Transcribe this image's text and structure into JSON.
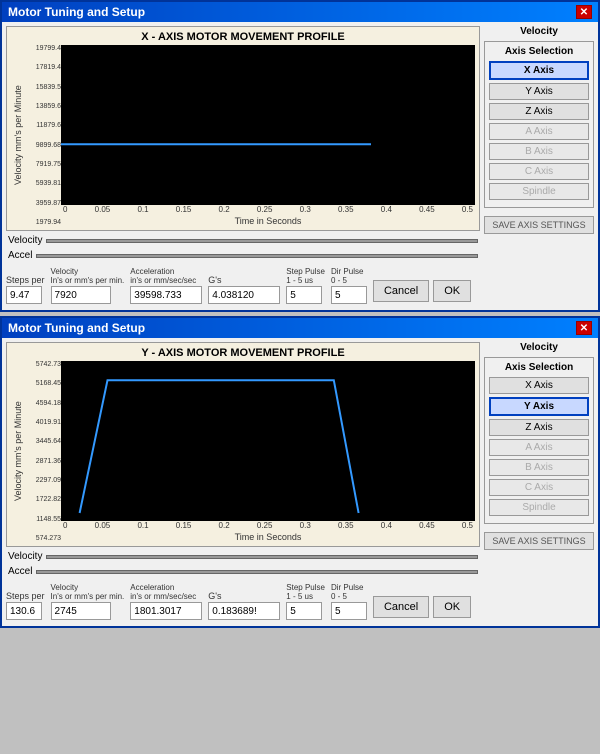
{
  "windows": [
    {
      "id": "window1",
      "title": "Motor Tuning and Setup",
      "chart_title": "X - AXIS MOTOR MOVEMENT PROFILE",
      "y_axis_label": "Velocity mm's per Minute",
      "x_axis_label": "Time in Seconds",
      "y_ticks": [
        "19799.4",
        "17819.4",
        "15839.5",
        "13859.6",
        "11879.6",
        "9899.68",
        "7919.75",
        "5939.81",
        "3959.87",
        "1979.94"
      ],
      "x_ticks": [
        "0",
        "0.05",
        "0.1",
        "0.15",
        "0.2",
        "0.25",
        "0.3",
        "0.35",
        "0.4",
        "0.45",
        "0.5"
      ],
      "velocity_label": "Velocity",
      "accel_label": "Accel",
      "line_y_pct": 0.62,
      "active_axis": "X Axis",
      "axis_buttons": [
        "X Axis",
        "Y Axis",
        "Z Axis",
        "A Axis",
        "B Axis",
        "C Axis",
        "Spindle"
      ],
      "inputs": {
        "steps_per_label": "Steps per",
        "steps_per_value": "9.47",
        "velocity_label": "Velocity\nIn's or mm's per min.",
        "velocity_value": "7920",
        "acceleration_label": "Acceleration\nin's or mm/sec/sec",
        "acceleration_value": "39598.733",
        "gs_label": "G's",
        "gs_value": "4.038120",
        "step_pulse_label": "Step Pulse\n1 - 5 us",
        "step_pulse_value": "5",
        "dir_pulse_label": "Dir Pulse\n0 - 5",
        "dir_pulse_value": "5"
      },
      "save_label": "SAVE AXIS SETTINGS",
      "cancel_label": "Cancel",
      "ok_label": "OK"
    },
    {
      "id": "window2",
      "title": "Motor Tuning and Setup",
      "chart_title": "Y - AXIS MOTOR MOVEMENT PROFILE",
      "y_axis_label": "Velocity mm's per Minute",
      "x_axis_label": "Time in Seconds",
      "y_ticks": [
        "5742.73",
        "5168.45",
        "4594.18",
        "4019.91",
        "3445.64",
        "2871.36",
        "2297.09",
        "1722.82",
        "1148.55",
        "574.273"
      ],
      "x_ticks": [
        "0",
        "0.05",
        "0.1",
        "0.15",
        "0.2",
        "0.25",
        "0.3",
        "0.35",
        "0.4",
        "0.45",
        "0.5"
      ],
      "velocity_label": "Velocity",
      "accel_label": "Accel",
      "trapezoid": true,
      "active_axis": "Y Axis",
      "axis_buttons": [
        "X Axis",
        "Y Axis",
        "Z Axis",
        "A Axis",
        "B Axis",
        "C Axis",
        "Spindle"
      ],
      "inputs": {
        "steps_per_label": "Steps per",
        "steps_per_value": "130.6",
        "velocity_label": "Velocity\nIn's or mm's per min.",
        "velocity_value": "2745",
        "acceleration_label": "Acceleration\nin's or mm/sec/sec",
        "acceleration_value": "1801.3017",
        "gs_label": "G's",
        "gs_value": "0.183689!",
        "step_pulse_label": "Step Pulse\n1 - 5 us",
        "step_pulse_value": "5",
        "dir_pulse_label": "Dir Pulse\n0 - 5",
        "dir_pulse_value": "5"
      },
      "save_label": "SAVE AXIS SETTINGS",
      "cancel_label": "Cancel",
      "ok_label": "OK"
    }
  ]
}
